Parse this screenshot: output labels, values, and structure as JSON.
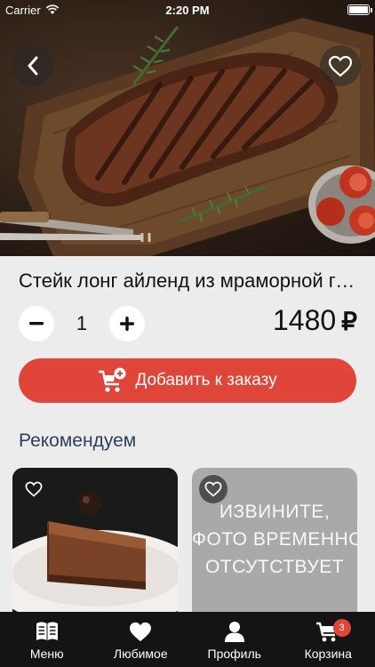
{
  "status": {
    "carrier": "Carrier",
    "time": "2:20 PM",
    "battery_level": 1.0
  },
  "product": {
    "title": "Стейк лонг айленд из мраморной говядины",
    "quantity": "1",
    "price": "1480",
    "currency": "₽",
    "add_to_order_label": "Добавить к заказу"
  },
  "recommendations": {
    "title": "Рекомендуем",
    "unavailable_text": [
      "ИЗВИНИТЕ,",
      "ФОТО ВРЕМЕННО",
      "ОТСУТСТВУЕТ"
    ]
  },
  "tabbar": {
    "items": [
      {
        "label": "Меню",
        "icon": "book-icon"
      },
      {
        "label": "Любимое",
        "icon": "heart-icon"
      },
      {
        "label": "Профиль",
        "icon": "person-icon"
      },
      {
        "label": "Корзина",
        "icon": "cart-icon",
        "badge": "3"
      }
    ]
  },
  "colors": {
    "accent": "#e0453a",
    "section_title": "#2d3f5e",
    "tabbar_bg": "#141414"
  }
}
